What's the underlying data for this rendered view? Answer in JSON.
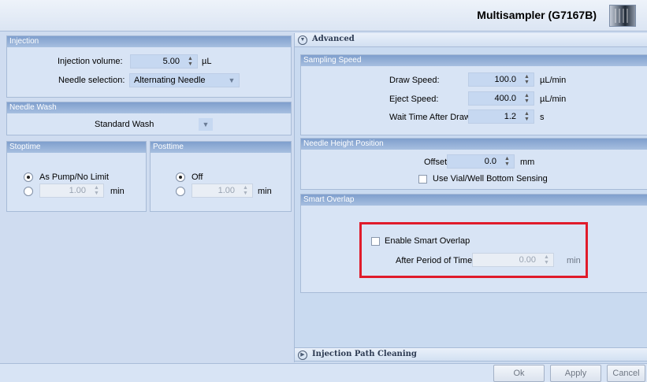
{
  "title": "Multisampler (G7167B)",
  "injection": {
    "header": "Injection",
    "volume_label": "Injection volume:",
    "volume_value": "5.00",
    "volume_unit": "µL",
    "needle_label": "Needle selection:",
    "needle_value": "Alternating Needle"
  },
  "needle_wash": {
    "header": "Needle Wash",
    "value": "Standard Wash"
  },
  "stoptime": {
    "header": "Stoptime",
    "option1": "As Pump/No Limit",
    "value": "1.00",
    "unit": "min"
  },
  "posttime": {
    "header": "Posttime",
    "option1": "Off",
    "value": "1.00",
    "unit": "min"
  },
  "advanced": {
    "label": "Advanced",
    "sampling_speed": {
      "header": "Sampling Speed",
      "draw_label": "Draw Speed:",
      "draw_value": "100.0",
      "draw_unit": "µL/min",
      "eject_label": "Eject Speed:",
      "eject_value": "400.0",
      "eject_unit": "µL/min",
      "wait_label": "Wait Time After Draw:",
      "wait_value": "1.2",
      "wait_unit": "s"
    },
    "needle_height": {
      "header": "Needle Height Position",
      "offset_label": "Offset:",
      "offset_value": "0.0",
      "offset_unit": "mm",
      "sensing_label": "Use Vial/Well Bottom Sensing"
    },
    "smart_overlap": {
      "header": "Smart Overlap",
      "enable_label": "Enable Smart Overlap",
      "period_label": "After Period of Time",
      "period_value": "0.00",
      "period_unit": "min"
    }
  },
  "injection_path_cleaning": {
    "label": "Injection Path Cleaning"
  },
  "buttons": {
    "ok": "Ok",
    "apply": "Apply",
    "cancel": "Cancel"
  },
  "highlight_color": "#e01b2b"
}
